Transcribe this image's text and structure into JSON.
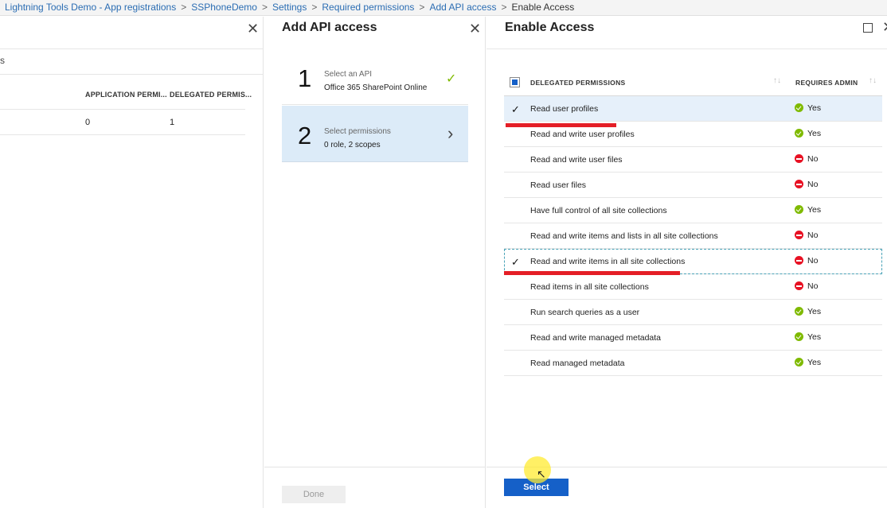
{
  "breadcrumb": {
    "items": [
      "Lightning Tools Demo - App registrations",
      "SSPhoneDemo",
      "Settings",
      "Required permissions",
      "Add API access"
    ],
    "current": "Enable Access",
    "separator": ">"
  },
  "left_blade": {
    "partial_label": "s",
    "columns": {
      "application": "APPLICATION PERMI...",
      "delegated": "DELEGATED PERMIS..."
    },
    "row": {
      "application": "0",
      "delegated": "1"
    }
  },
  "add_api_blade": {
    "title": "Add API access",
    "steps": [
      {
        "number": "1",
        "label": "Select an API",
        "value": "Office 365 SharePoint Online",
        "completed": true
      },
      {
        "number": "2",
        "label": "Select permissions",
        "value": "0 role, 2 scopes",
        "completed": false
      }
    ],
    "done_label": "Done"
  },
  "enable_access_blade": {
    "title": "Enable Access",
    "headers": {
      "permission": "DELEGATED PERMISSIONS",
      "admin": "REQUIRES ADMIN"
    },
    "permissions": [
      {
        "label": "Read user profiles",
        "checked": true,
        "admin": "Yes"
      },
      {
        "label": "Read and write user profiles",
        "checked": false,
        "admin": "Yes"
      },
      {
        "label": "Read and write user files",
        "checked": false,
        "admin": "No"
      },
      {
        "label": "Read user files",
        "checked": false,
        "admin": "No"
      },
      {
        "label": "Have full control of all site collections",
        "checked": false,
        "admin": "Yes"
      },
      {
        "label": "Read and write items and lists in all site collections",
        "checked": false,
        "admin": "No"
      },
      {
        "label": "Read and write items in all site collections",
        "checked": true,
        "admin": "No"
      },
      {
        "label": "Read items in all site collections",
        "checked": false,
        "admin": "No"
      },
      {
        "label": "Run search queries as a user",
        "checked": false,
        "admin": "Yes"
      },
      {
        "label": "Read and write managed metadata",
        "checked": false,
        "admin": "Yes"
      },
      {
        "label": "Read managed metadata",
        "checked": false,
        "admin": "Yes"
      }
    ],
    "select_label": "Select"
  },
  "icons": {
    "close": "✕",
    "check": "✓",
    "chevron_right": "›",
    "sort": "↑↓"
  },
  "colors": {
    "link": "#2b6db3",
    "accent": "#1560c8",
    "yes": "#7fba00",
    "no": "#e81123",
    "annotation": "#e41e26",
    "selected_row": "#e6f0fa"
  }
}
